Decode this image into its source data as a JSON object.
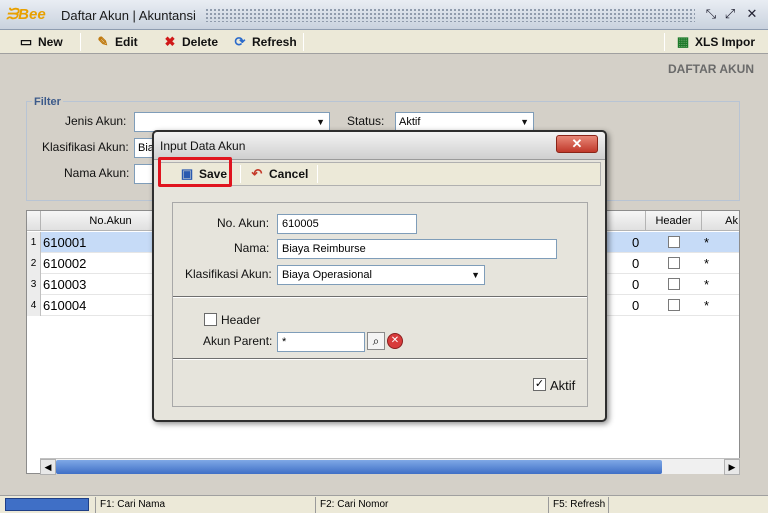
{
  "window": {
    "logo": "ᙐBee",
    "title": "Daftar Akun | Akuntansi",
    "controls": [
      "⤡",
      "⤢",
      "✕"
    ]
  },
  "toolbar": {
    "new_label": "New",
    "edit_label": "Edit",
    "delete_label": "Delete",
    "refresh_label": "Refresh",
    "import_label": "XLS Impor"
  },
  "page_heading": "DAFTAR AKUN",
  "filter": {
    "legend": "Filter",
    "jenis_label": "Jenis Akun:",
    "jenis_value": "",
    "status_label": "Status:",
    "status_value": "Aktif",
    "klasifikasi_label": "Klasifikasi Akun:",
    "klasifikasi_value": "Bia",
    "nama_label": "Nama Akun:",
    "nama_value": ""
  },
  "grid": {
    "columns": [
      "No.Akun",
      "Header",
      "Ak"
    ],
    "rows": [
      {
        "rn": "1",
        "no_akun": "610001",
        "value": "0",
        "ak": "*"
      },
      {
        "rn": "2",
        "no_akun": "610002",
        "value": "0",
        "ak": "*"
      },
      {
        "rn": "3",
        "no_akun": "610003",
        "value": "0",
        "ak": "*"
      },
      {
        "rn": "4",
        "no_akun": "610004",
        "value": "0",
        "ak": "*"
      }
    ]
  },
  "statusbar": {
    "f1": "F1: Cari Nama",
    "f2": "F2: Cari Nomor",
    "f5": "F5: Refresh"
  },
  "dialog": {
    "title": "Input Data Akun",
    "close": "✕",
    "save_label": "Save",
    "cancel_label": "Cancel",
    "no_akun_label": "No. Akun:",
    "no_akun_value": "610005",
    "nama_label": "Nama:",
    "nama_value": "Biaya Reimburse",
    "klasifikasi_label": "Klasifikasi Akun:",
    "klasifikasi_value": "Biaya Operasional",
    "header_label": "Header",
    "akun_parent_label": "Akun Parent:",
    "akun_parent_value": "*",
    "aktif_label": "Aktif",
    "aktif_check": "✓"
  },
  "colors": {
    "accent_highlight": "#e0141e",
    "selected_row": "#c6dbf7",
    "scroll_thumb": "#3f6fc6"
  }
}
